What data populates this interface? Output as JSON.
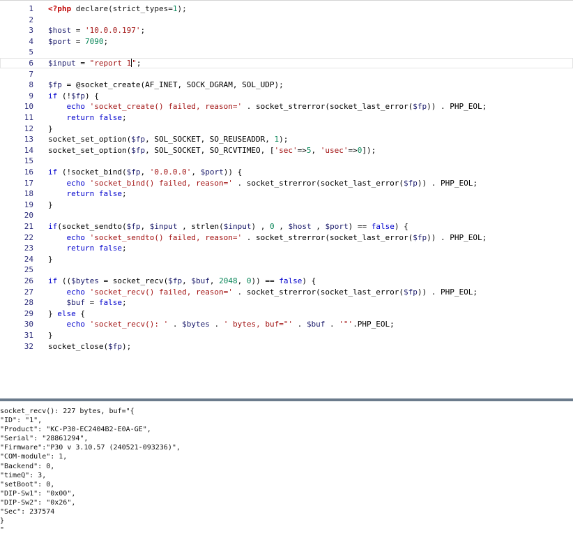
{
  "editor": {
    "current_line": 6,
    "lines": [
      {
        "n": "1",
        "tokens": [
          [
            "php",
            "<?php"
          ],
          [
            "fn",
            " declare(strict_types="
          ],
          [
            "num",
            "1"
          ],
          [
            "fn",
            ");"
          ]
        ]
      },
      {
        "n": "2",
        "tokens": []
      },
      {
        "n": "3",
        "tokens": [
          [
            "var",
            "$host"
          ],
          [
            "op",
            " = "
          ],
          [
            "str",
            "'10.0.0.197'"
          ],
          [
            "op",
            ";"
          ]
        ]
      },
      {
        "n": "4",
        "tokens": [
          [
            "var",
            "$port"
          ],
          [
            "op",
            " = "
          ],
          [
            "num",
            "7090"
          ],
          [
            "op",
            ";"
          ]
        ]
      },
      {
        "n": "5",
        "tokens": []
      },
      {
        "n": "6",
        "tokens": [
          [
            "var",
            "$input"
          ],
          [
            "op",
            " = "
          ],
          [
            "str",
            "\"report 1"
          ],
          [
            "cursor",
            ""
          ],
          [
            "str",
            "\""
          ],
          [
            "op",
            ";"
          ]
        ]
      },
      {
        "n": "7",
        "tokens": []
      },
      {
        "n": "8",
        "tokens": [
          [
            "var",
            "$fp"
          ],
          [
            "op",
            " = @socket_create(AF_INET, SOCK_DGRAM, SOL_UDP);"
          ]
        ]
      },
      {
        "n": "9",
        "tokens": [
          [
            "kw",
            "if"
          ],
          [
            "op",
            " (!"
          ],
          [
            "var",
            "$fp"
          ],
          [
            "op",
            ") {"
          ]
        ]
      },
      {
        "n": "10",
        "tokens": [
          [
            "op",
            "    "
          ],
          [
            "kw",
            "echo"
          ],
          [
            "op",
            " "
          ],
          [
            "str",
            "'socket_create() failed, reason='"
          ],
          [
            "op",
            " . socket_strerror(socket_last_error("
          ],
          [
            "var",
            "$fp"
          ],
          [
            "op",
            ")) . PHP_EOL;"
          ]
        ]
      },
      {
        "n": "11",
        "tokens": [
          [
            "op",
            "    "
          ],
          [
            "kw",
            "return"
          ],
          [
            "op",
            " "
          ],
          [
            "kw",
            "false"
          ],
          [
            "op",
            ";"
          ]
        ]
      },
      {
        "n": "12",
        "tokens": [
          [
            "op",
            "}"
          ]
        ]
      },
      {
        "n": "13",
        "tokens": [
          [
            "op",
            "socket_set_option("
          ],
          [
            "var",
            "$fp"
          ],
          [
            "op",
            ", SOL_SOCKET, SO_REUSEADDR, "
          ],
          [
            "num",
            "1"
          ],
          [
            "op",
            ");"
          ]
        ]
      },
      {
        "n": "14",
        "tokens": [
          [
            "op",
            "socket_set_option("
          ],
          [
            "var",
            "$fp"
          ],
          [
            "op",
            ", SOL_SOCKET, SO_RCVTIMEO, ["
          ],
          [
            "str",
            "'sec'"
          ],
          [
            "op",
            "=>"
          ],
          [
            "num",
            "5"
          ],
          [
            "op",
            ", "
          ],
          [
            "str",
            "'usec'"
          ],
          [
            "op",
            "=>"
          ],
          [
            "num",
            "0"
          ],
          [
            "op",
            "]);"
          ]
        ]
      },
      {
        "n": "15",
        "tokens": []
      },
      {
        "n": "16",
        "tokens": [
          [
            "kw",
            "if"
          ],
          [
            "op",
            " (!socket_bind("
          ],
          [
            "var",
            "$fp"
          ],
          [
            "op",
            ", "
          ],
          [
            "str",
            "'0.0.0.0'"
          ],
          [
            "op",
            ", "
          ],
          [
            "var",
            "$port"
          ],
          [
            "op",
            ")) {"
          ]
        ]
      },
      {
        "n": "17",
        "tokens": [
          [
            "op",
            "    "
          ],
          [
            "kw",
            "echo"
          ],
          [
            "op",
            " "
          ],
          [
            "str",
            "'socket_bind() failed, reason='"
          ],
          [
            "op",
            " . socket_strerror(socket_last_error("
          ],
          [
            "var",
            "$fp"
          ],
          [
            "op",
            ")) . PHP_EOL;"
          ]
        ]
      },
      {
        "n": "18",
        "tokens": [
          [
            "op",
            "    "
          ],
          [
            "kw",
            "return"
          ],
          [
            "op",
            " "
          ],
          [
            "kw",
            "false"
          ],
          [
            "op",
            ";"
          ]
        ]
      },
      {
        "n": "19",
        "tokens": [
          [
            "op",
            "}"
          ]
        ]
      },
      {
        "n": "20",
        "tokens": []
      },
      {
        "n": "21",
        "tokens": [
          [
            "kw",
            "if"
          ],
          [
            "op",
            "(socket_sendto("
          ],
          [
            "var",
            "$fp"
          ],
          [
            "op",
            ", "
          ],
          [
            "var",
            "$input"
          ],
          [
            "op",
            " , strlen("
          ],
          [
            "var",
            "$input"
          ],
          [
            "op",
            ") , "
          ],
          [
            "num",
            "0"
          ],
          [
            "op",
            " , "
          ],
          [
            "var",
            "$host"
          ],
          [
            "op",
            " , "
          ],
          [
            "var",
            "$port"
          ],
          [
            "op",
            ") == "
          ],
          [
            "kw",
            "false"
          ],
          [
            "op",
            ") {"
          ]
        ]
      },
      {
        "n": "22",
        "tokens": [
          [
            "op",
            "    "
          ],
          [
            "kw",
            "echo"
          ],
          [
            "op",
            " "
          ],
          [
            "str",
            "'socket_sendto() failed, reason='"
          ],
          [
            "op",
            " . socket_strerror(socket_last_error("
          ],
          [
            "var",
            "$fp"
          ],
          [
            "op",
            ")) . PHP_EOL;"
          ]
        ]
      },
      {
        "n": "23",
        "tokens": [
          [
            "op",
            "    "
          ],
          [
            "kw",
            "return"
          ],
          [
            "op",
            " "
          ],
          [
            "kw",
            "false"
          ],
          [
            "op",
            ";"
          ]
        ]
      },
      {
        "n": "24",
        "tokens": [
          [
            "op",
            "}"
          ]
        ]
      },
      {
        "n": "25",
        "tokens": []
      },
      {
        "n": "26",
        "tokens": [
          [
            "kw",
            "if"
          ],
          [
            "op",
            " (("
          ],
          [
            "var",
            "$bytes"
          ],
          [
            "op",
            " = socket_recv("
          ],
          [
            "var",
            "$fp"
          ],
          [
            "op",
            ", "
          ],
          [
            "var",
            "$buf"
          ],
          [
            "op",
            ", "
          ],
          [
            "num",
            "2048"
          ],
          [
            "op",
            ", "
          ],
          [
            "num",
            "0"
          ],
          [
            "op",
            ")) == "
          ],
          [
            "kw",
            "false"
          ],
          [
            "op",
            ") {"
          ]
        ]
      },
      {
        "n": "27",
        "tokens": [
          [
            "op",
            "    "
          ],
          [
            "kw",
            "echo"
          ],
          [
            "op",
            " "
          ],
          [
            "str",
            "'socket_recv() failed, reason='"
          ],
          [
            "op",
            " . socket_strerror(socket_last_error("
          ],
          [
            "var",
            "$fp"
          ],
          [
            "op",
            ")) . PHP_EOL;"
          ]
        ]
      },
      {
        "n": "28",
        "tokens": [
          [
            "op",
            "    "
          ],
          [
            "var",
            "$buf"
          ],
          [
            "op",
            " = "
          ],
          [
            "kw",
            "false"
          ],
          [
            "op",
            ";"
          ]
        ]
      },
      {
        "n": "29",
        "tokens": [
          [
            "op",
            "} "
          ],
          [
            "kw",
            "else"
          ],
          [
            "op",
            " {"
          ]
        ]
      },
      {
        "n": "30",
        "tokens": [
          [
            "op",
            "    "
          ],
          [
            "kw",
            "echo"
          ],
          [
            "op",
            " "
          ],
          [
            "str",
            "'socket_recv(): '"
          ],
          [
            "op",
            " . "
          ],
          [
            "var",
            "$bytes"
          ],
          [
            "op",
            " . "
          ],
          [
            "str",
            "' bytes, buf=\"'"
          ],
          [
            "op",
            " . "
          ],
          [
            "var",
            "$buf"
          ],
          [
            "op",
            " . "
          ],
          [
            "str",
            "'\"'"
          ],
          [
            "op",
            ".PHP_EOL;"
          ]
        ]
      },
      {
        "n": "31",
        "tokens": [
          [
            "op",
            "}"
          ]
        ]
      },
      {
        "n": "32",
        "tokens": [
          [
            "op",
            "socket_close("
          ],
          [
            "var",
            "$fp"
          ],
          [
            "op",
            ");"
          ]
        ]
      }
    ]
  },
  "output": {
    "lines": [
      "socket_recv(): 227 bytes, buf=\"{",
      "\"ID\": \"1\",",
      "\"Product\": \"KC-P30-EC2404B2-E0A-GE\",",
      "\"Serial\": \"28861294\",",
      "\"Firmware\":\"P30 v 3.10.57 (240521-093236)\",",
      "\"COM-module\": 1,",
      "\"Backend\": 0,",
      "\"timeQ\": 3,",
      "\"setBoot\": 0,",
      "\"DIP-Sw1\": \"0x00\",",
      "\"DIP-Sw2\": \"0x26\",",
      "\"Sec\": 237574",
      "}",
      "\""
    ]
  }
}
